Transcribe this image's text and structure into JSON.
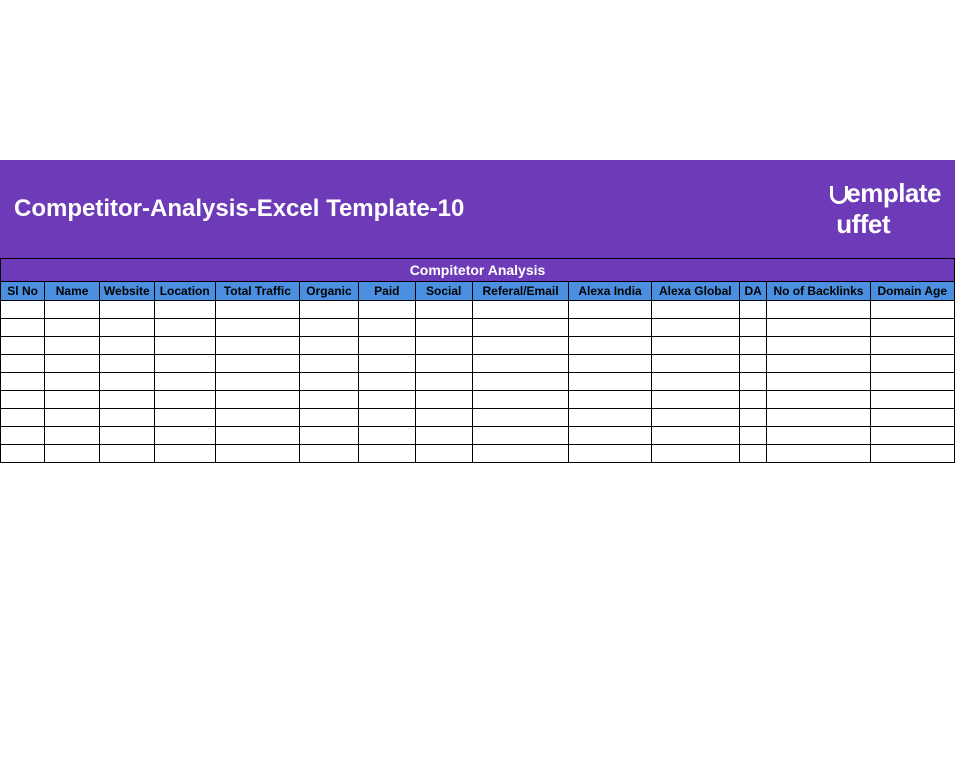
{
  "header": {
    "title": "Competitor-Analysis-Excel Template-10",
    "logo_text": "emplate",
    "logo_text2": "uffet"
  },
  "table": {
    "title": "Compitetor Analysis",
    "columns": [
      "Sl No",
      "Name",
      "Website",
      "Location",
      "Total Traffic",
      "Organic",
      "Paid",
      "Social",
      "Referal/Email",
      "Alexa India",
      "Alexa Global",
      "DA",
      "No of Backlinks",
      "Domain Age"
    ],
    "rows": [
      [
        "",
        "",
        "",
        "",
        "",
        "",
        "",
        "",
        "",
        "",
        "",
        "",
        "",
        ""
      ],
      [
        "",
        "",
        "",
        "",
        "",
        "",
        "",
        "",
        "",
        "",
        "",
        "",
        "",
        ""
      ],
      [
        "",
        "",
        "",
        "",
        "",
        "",
        "",
        "",
        "",
        "",
        "",
        "",
        "",
        ""
      ],
      [
        "",
        "",
        "",
        "",
        "",
        "",
        "",
        "",
        "",
        "",
        "",
        "",
        "",
        ""
      ],
      [
        "",
        "",
        "",
        "",
        "",
        "",
        "",
        "",
        "",
        "",
        "",
        "",
        "",
        ""
      ],
      [
        "",
        "",
        "",
        "",
        "",
        "",
        "",
        "",
        "",
        "",
        "",
        "",
        "",
        ""
      ],
      [
        "",
        "",
        "",
        "",
        "",
        "",
        "",
        "",
        "",
        "",
        "",
        "",
        "",
        ""
      ],
      [
        "",
        "",
        "",
        "",
        "",
        "",
        "",
        "",
        "",
        "",
        "",
        "",
        "",
        ""
      ],
      [
        "",
        "",
        "",
        "",
        "",
        "",
        "",
        "",
        "",
        "",
        "",
        "",
        "",
        ""
      ]
    ]
  }
}
